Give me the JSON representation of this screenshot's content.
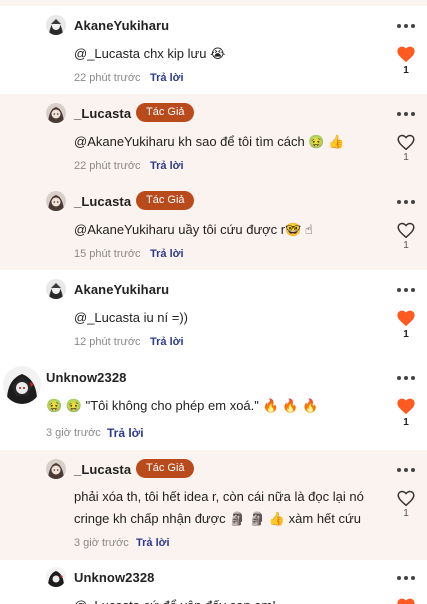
{
  "comments": [
    {
      "username": "AkaneYukiharu",
      "badge": "",
      "text": "@_Lucasta chx kip lưu 😭",
      "time": "22 phút trước",
      "reply_label": "Trả lời",
      "likes": "1",
      "liked": true
    },
    {
      "username": "_Lucasta",
      "badge": "Tác Giả",
      "text": "@AkaneYukiharu kh sao để tôi tìm cách 🤢 👍",
      "time": "22 phút trước",
      "reply_label": "Trả lời",
      "likes": "1",
      "liked": false
    },
    {
      "username": "_Lucasta",
      "badge": "Tác Giả",
      "text": "@AkaneYukiharu uầy tôi cứu được r🤓 ☝",
      "time": "15 phút trước",
      "reply_label": "Trả lời",
      "likes": "1",
      "liked": false
    },
    {
      "username": "AkaneYukiharu",
      "badge": "",
      "text": "@_Lucasta iu ní =))",
      "time": "12 phút trước",
      "reply_label": "Trả lời",
      "likes": "1",
      "liked": true
    },
    {
      "username": "Unknow2328",
      "badge": "",
      "text": "🤢 🤢 \"Tôi không cho phép em xoá.\" 🔥 🔥 🔥",
      "time": "3 giờ trước",
      "reply_label": "Trả lời",
      "likes": "1",
      "liked": true
    },
    {
      "username": "_Lucasta",
      "badge": "Tác Giả",
      "text_line1": "phải xóa th, tôi hết idea r, còn cái nữa là đọc lại nó",
      "text_line2": "cringe kh chấp nhận được 🗿 🗿 👍  xàm hết cứu",
      "time": "3 giờ trước",
      "reply_label": "Trả lời",
      "likes": "1",
      "liked": false
    },
    {
      "username": "Unknow2328",
      "badge": "",
      "text": "@_Lucasta cứ để yên đấy con em!",
      "time": "",
      "reply_label": "",
      "likes": "",
      "liked": true
    }
  ],
  "icons": {
    "more": "more-options-icon",
    "heart_filled": "heart-filled-icon",
    "heart_outline": "heart-outline-icon"
  },
  "colors": {
    "heart_fill": "#ff5a1f",
    "badge_bg": "#b84a1b",
    "author_row_bg": "#fbf3ef",
    "reply_link": "#2d3a8c"
  }
}
